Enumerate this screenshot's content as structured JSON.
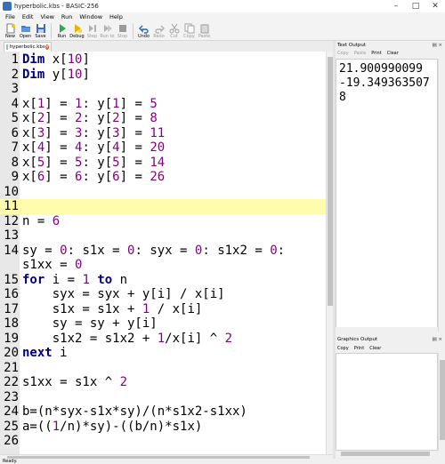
{
  "window": {
    "title": "hyperbolic.kbs - BASIC-256"
  },
  "menu": [
    "File",
    "Edit",
    "View",
    "Run",
    "Window",
    "Help"
  ],
  "toolbar": {
    "new": "New",
    "open": "Open",
    "save": "Save",
    "run": "Run",
    "debug": "Debug",
    "step": "Step",
    "run_to": "Run to",
    "stop": "Stop",
    "undo": "Undo",
    "redo": "Redo",
    "cut": "Cut",
    "copy": "Copy",
    "paste": "Paste"
  },
  "editor": {
    "tab_label": "hyperbolic.kbs",
    "current_line": 11,
    "lines": [
      {
        "n": "1",
        "code": "Dim x[10]"
      },
      {
        "n": "2",
        "code": "Dim y[10]"
      },
      {
        "n": "3",
        "code": ""
      },
      {
        "n": "4",
        "code": "x[1] = 1: y[1] = 5"
      },
      {
        "n": "5",
        "code": "x[2] = 2: y[2] = 8"
      },
      {
        "n": "6",
        "code": "x[3] = 3: y[3] = 11"
      },
      {
        "n": "7",
        "code": "x[4] = 4: y[4] = 20"
      },
      {
        "n": "8",
        "code": "x[5] = 5: y[5] = 14"
      },
      {
        "n": "9",
        "code": "x[6] = 6: y[6] = 26"
      },
      {
        "n": "10",
        "code": ""
      },
      {
        "n": "11",
        "code": ""
      },
      {
        "n": "12",
        "code": "n = 6"
      },
      {
        "n": "13",
        "code": ""
      },
      {
        "n": "14",
        "code": "sy = 0: s1x = 0: syx = 0: s1x2 = 0:"
      },
      {
        "n": "",
        "code": "s1xx = 0"
      },
      {
        "n": "15",
        "code": "for i = 1 to n"
      },
      {
        "n": "16",
        "code": "    syx = syx + y[i] / x[i]"
      },
      {
        "n": "17",
        "code": "    s1x = s1x + 1 / x[i]"
      },
      {
        "n": "18",
        "code": "    sy = sy + y[i]"
      },
      {
        "n": "19",
        "code": "    s1x2 = s1x2 + 1/x[i] ^ 2"
      },
      {
        "n": "20",
        "code": "next i"
      },
      {
        "n": "21",
        "code": ""
      },
      {
        "n": "22",
        "code": "s1xx = s1x ^ 2"
      },
      {
        "n": "23",
        "code": ""
      },
      {
        "n": "24",
        "code": "b=(n*syx-s1x*sy)/(n*s1x2-s1xx)"
      },
      {
        "n": "25",
        "code": "a=((1/n)*sy)-((b/n)*s1x)"
      },
      {
        "n": "26",
        "code": ""
      }
    ]
  },
  "text_output": {
    "title": "Text Output",
    "tools": [
      "Copy",
      "Paste",
      "Print",
      "Clear"
    ],
    "lines": [
      "21.900990099",
      "-19.349363507",
      "8"
    ]
  },
  "graphics_output": {
    "title": "Graphics Output",
    "tools": [
      "Copy",
      "Print",
      "Clear"
    ]
  },
  "status": {
    "text": "Ready."
  }
}
